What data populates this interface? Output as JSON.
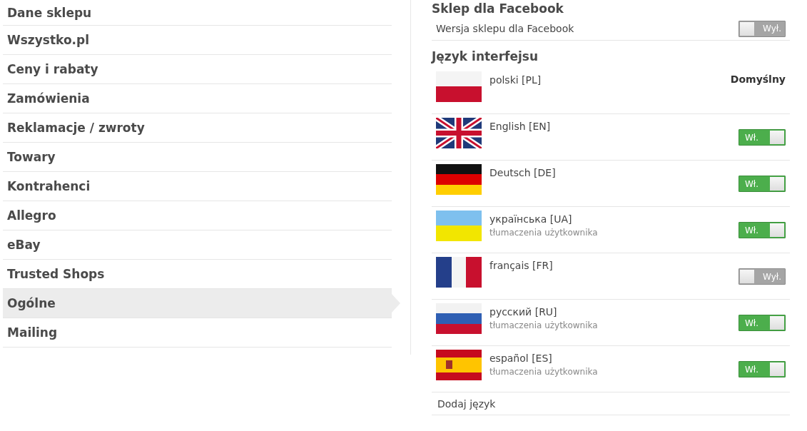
{
  "sidebar": {
    "items": [
      {
        "label": "Dane sklepu",
        "selected": false
      },
      {
        "label": "Wszystko.pl",
        "selected": false
      },
      {
        "label": "Ceny i rabaty",
        "selected": false
      },
      {
        "label": "Zamówienia",
        "selected": false
      },
      {
        "label": "Reklamacje / zwroty",
        "selected": false
      },
      {
        "label": "Towary",
        "selected": false
      },
      {
        "label": "Kontrahenci",
        "selected": false
      },
      {
        "label": "Allegro",
        "selected": false
      },
      {
        "label": "eBay",
        "selected": false
      },
      {
        "label": "Trusted Shops",
        "selected": false
      },
      {
        "label": "Ogólne",
        "selected": true
      },
      {
        "label": "Mailing",
        "selected": false
      }
    ]
  },
  "facebook": {
    "heading": "Sklep dla Facebook",
    "label": "Wersja sklepu dla Facebook",
    "on": false,
    "switch_label": "Wył."
  },
  "languages": {
    "heading": "Język interfejsu",
    "items": [
      {
        "flag": {
          "kind": "pl"
        },
        "name": "polski [PL]",
        "kind": "default",
        "badge": "Domyślny"
      },
      {
        "flag": {
          "kind": "en"
        },
        "name": "English [EN]",
        "kind": "toggle",
        "on": true,
        "switch_label": "Wł."
      },
      {
        "flag": {
          "kind": "de"
        },
        "name": "Deutsch [DE]",
        "kind": "toggle",
        "on": true,
        "switch_label": "Wł."
      },
      {
        "flag": {
          "kind": "ua"
        },
        "name": "українська [UA]",
        "note": "tłumaczenia użytkownika",
        "kind": "toggle",
        "on": true,
        "switch_label": "Wł."
      },
      {
        "flag": {
          "kind": "fr"
        },
        "name": "français [FR]",
        "kind": "toggle",
        "on": false,
        "switch_label": "Wył."
      },
      {
        "flag": {
          "kind": "ru"
        },
        "name": "русский [RU]",
        "note": "tłumaczenia użytkownika",
        "kind": "toggle",
        "on": true,
        "switch_label": "Wł."
      },
      {
        "flag": {
          "kind": "es"
        },
        "name": "español [ES]",
        "note": "tłumaczenia użytkownika",
        "kind": "toggle",
        "on": true,
        "switch_label": "Wł."
      }
    ],
    "add_label": "Dodaj język"
  }
}
